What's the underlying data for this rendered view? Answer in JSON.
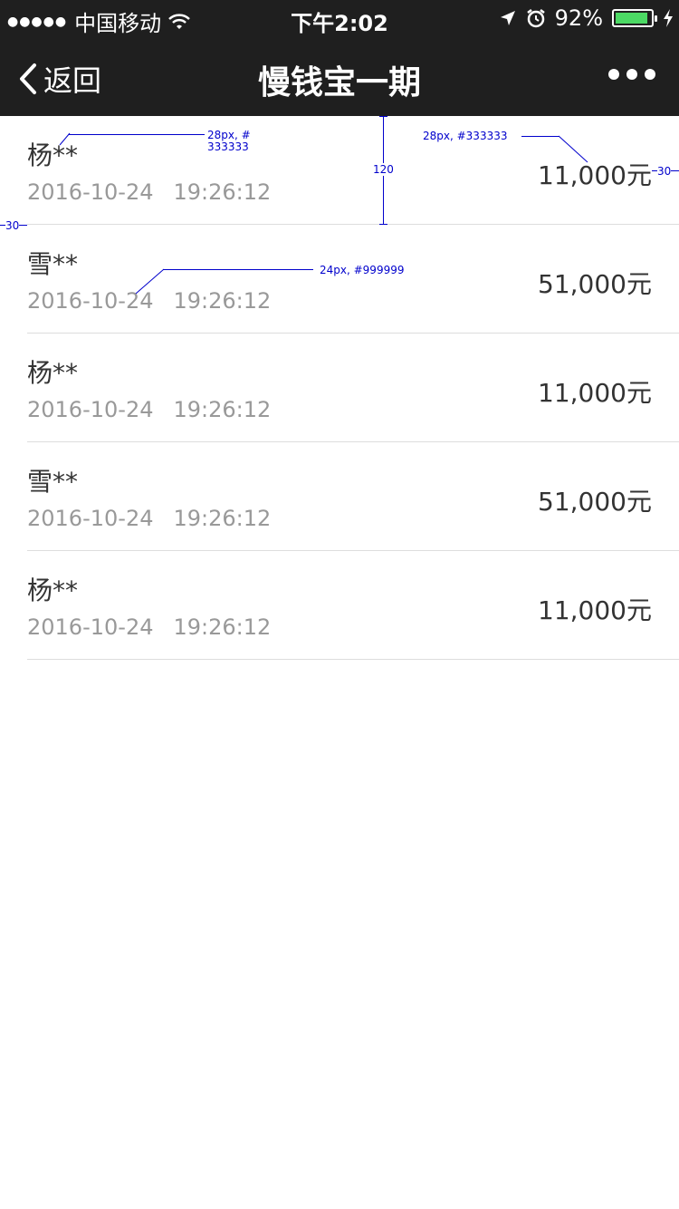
{
  "status_bar": {
    "signal_dots": "●●●●●",
    "carrier": "中国移动",
    "time": "下午2:02",
    "battery_percent": "92%",
    "battery_level": 0.92,
    "icons": [
      "wifi-icon",
      "location-icon",
      "alarm-icon",
      "battery-icon",
      "charging-icon"
    ]
  },
  "nav": {
    "back_label": "返回",
    "title": "慢钱宝一期",
    "more_icon": "more-dots-icon"
  },
  "records": [
    {
      "name": "杨**",
      "date": "2016-10-24",
      "time": "19:26:12",
      "amount": "11,000元"
    },
    {
      "name": "雪**",
      "date": "2016-10-24",
      "time": "19:26:12",
      "amount": "51,000元"
    },
    {
      "name": "杨**",
      "date": "2016-10-24",
      "time": "19:26:12",
      "amount": "11,000元"
    },
    {
      "name": "雪**",
      "date": "2016-10-24",
      "time": "19:26:12",
      "amount": "51,000元"
    },
    {
      "name": "杨**",
      "date": "2016-10-24",
      "time": "19:26:12",
      "amount": "11,000元"
    }
  ],
  "annotations": {
    "name_font": "28px, #",
    "name_color": "333333",
    "amount_font": "28px, #333333",
    "row_height": "120",
    "right_padding": "30",
    "left_padding": "30",
    "date_font": "24px, #999999"
  },
  "colors": {
    "header_bg": "#1f1f1f",
    "primary_text": "#333333",
    "secondary_text": "#999999",
    "annotation": "#0000cc",
    "battery_fill": "#4cd964"
  }
}
